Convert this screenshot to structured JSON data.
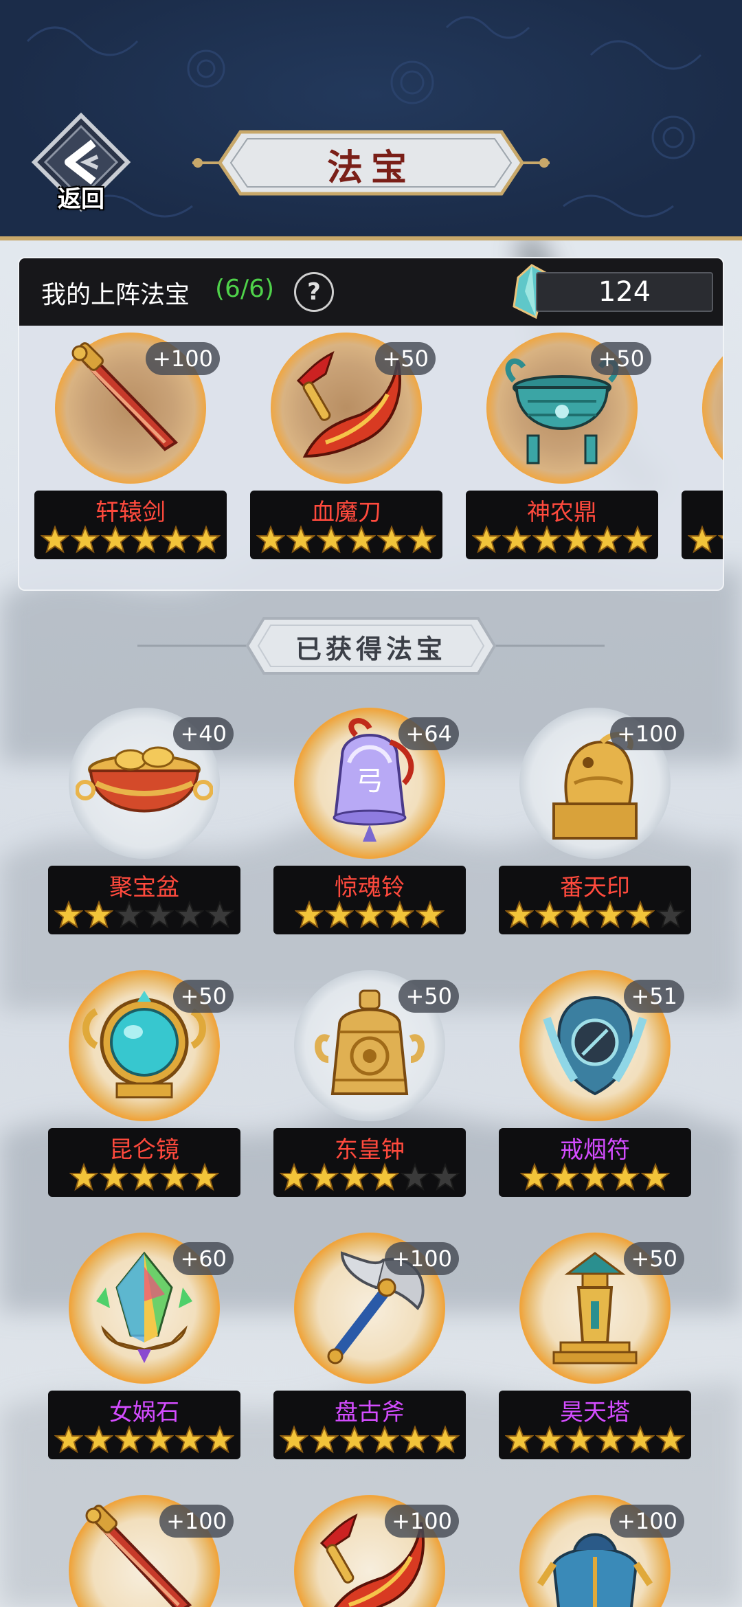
{
  "header": {
    "back_label": "返回",
    "title": "法宝"
  },
  "equipped": {
    "label": "我的上阵法宝",
    "count": "(6/6)",
    "help": "?",
    "crystal_amount": "124",
    "items": [
      {
        "name": "轩辕剑",
        "bonus": "+100",
        "stars": 6,
        "max_stars": 6,
        "icon": "sword-icon"
      },
      {
        "name": "血魔刀",
        "bonus": "+50",
        "stars": 6,
        "max_stars": 6,
        "icon": "blade-icon"
      },
      {
        "name": "神农鼎",
        "bonus": "+50",
        "stars": 6,
        "max_stars": 6,
        "icon": "cauldron-icon"
      }
    ]
  },
  "obtained": {
    "title": "已获得法宝",
    "items": [
      {
        "name": "聚宝盆",
        "bonus": "+40",
        "stars": 2,
        "max_stars": 6,
        "halo": "silver",
        "name_color": "red",
        "icon": "treasure-bowl-icon"
      },
      {
        "name": "惊魂铃",
        "bonus": "+64",
        "stars": 5,
        "max_stars": 5,
        "halo": "gold",
        "name_color": "red",
        "icon": "bell-icon"
      },
      {
        "name": "番天印",
        "bonus": "+100",
        "stars": 5,
        "max_stars": 6,
        "halo": "silver",
        "name_color": "red",
        "icon": "seal-icon"
      },
      {
        "name": "昆仑镜",
        "bonus": "+50",
        "stars": 5,
        "max_stars": 5,
        "halo": "gold",
        "name_color": "red",
        "icon": "mirror-icon"
      },
      {
        "name": "东皇钟",
        "bonus": "+50",
        "stars": 4,
        "max_stars": 6,
        "halo": "silver",
        "name_color": "red",
        "icon": "great-bell-icon"
      },
      {
        "name": "戒烟符",
        "bonus": "+51",
        "stars": 5,
        "max_stars": 5,
        "halo": "gold",
        "name_color": "purple",
        "icon": "talisman-icon"
      },
      {
        "name": "女娲石",
        "bonus": "+60",
        "stars": 6,
        "max_stars": 6,
        "halo": "gold",
        "name_color": "purple",
        "icon": "crystal-stone-icon"
      },
      {
        "name": "盘古斧",
        "bonus": "+100",
        "stars": 6,
        "max_stars": 6,
        "halo": "gold",
        "name_color": "purple",
        "icon": "axe-icon"
      },
      {
        "name": "昊天塔",
        "bonus": "+50",
        "stars": 6,
        "max_stars": 6,
        "halo": "gold",
        "name_color": "purple",
        "icon": "pagoda-icon"
      },
      {
        "name": "",
        "bonus": "+100",
        "stars": 0,
        "max_stars": 0,
        "halo": "gold",
        "name_color": "red",
        "icon": "sword-icon"
      },
      {
        "name": "",
        "bonus": "+100",
        "stars": 0,
        "max_stars": 0,
        "halo": "gold",
        "name_color": "red",
        "icon": "blade-icon"
      },
      {
        "name": "",
        "bonus": "+100",
        "stars": 0,
        "max_stars": 0,
        "halo": "gold",
        "name_color": "red",
        "icon": "armor-icon"
      }
    ]
  },
  "colors": {
    "header_bg": "#1b2c49",
    "gold_trim": "#c8a86a",
    "name_red": "#ff4a3d",
    "name_purple": "#d44cff",
    "count_green": "#4fd24a"
  }
}
